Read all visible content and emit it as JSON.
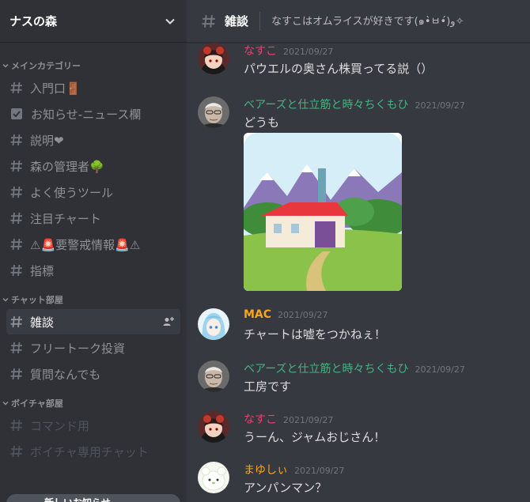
{
  "server": {
    "name": "ナスの森"
  },
  "sidebar": {
    "categories": [
      {
        "label": "メインカテゴリー"
      },
      {
        "label": "チャット部屋"
      },
      {
        "label": "ボイチャ部屋"
      }
    ],
    "channels": [
      {
        "label": "入門口🚪"
      },
      {
        "label": "お知らせ-ニュース欄"
      },
      {
        "label": "説明❤"
      },
      {
        "label": "森の管理者🌳"
      },
      {
        "label": "よく使うツール"
      },
      {
        "label": "注目チャート"
      },
      {
        "label": "⚠🚨要警戒情報🚨⚠"
      },
      {
        "label": "指標"
      },
      {
        "label": "雑談"
      },
      {
        "label": "フリートーク投資"
      },
      {
        "label": "質問なんでも"
      },
      {
        "label": "コマンド用"
      },
      {
        "label": "ボイチャ専用チャット"
      }
    ],
    "new_messages_label": "新しいお知らせ"
  },
  "channel": {
    "title": "雑談",
    "topic": "なすこはオムライスが好きです(๑•̀ㅂ•́)و✧"
  },
  "messages": [
    {
      "author": "なすこ",
      "author_color": "#e9426b",
      "time": "2021/09/27",
      "text": "パウエルの奥さん株買ってる説（）"
    },
    {
      "author": "ベアーズと仕立筋と時々ちくもひ",
      "author_color": "#43b581",
      "time": "2021/09/27",
      "text": "どうも"
    },
    {
      "author": "MAC",
      "author_color": "#faa61a",
      "time": "2021/09/27",
      "text": "チャートは嘘をつかねぇ！"
    },
    {
      "author": "ベアーズと仕立筋と時々ちくもひ",
      "author_color": "#43b581",
      "time": "2021/09/27",
      "text": "工房です"
    },
    {
      "author": "なすこ",
      "author_color": "#e9426b",
      "time": "2021/09/27",
      "text": "うーん、ジャムおじさん！"
    },
    {
      "author": "まゆしぃ",
      "author_color": "#faa61a",
      "time": "2021/09/27",
      "text": "アンパンマン？"
    }
  ]
}
